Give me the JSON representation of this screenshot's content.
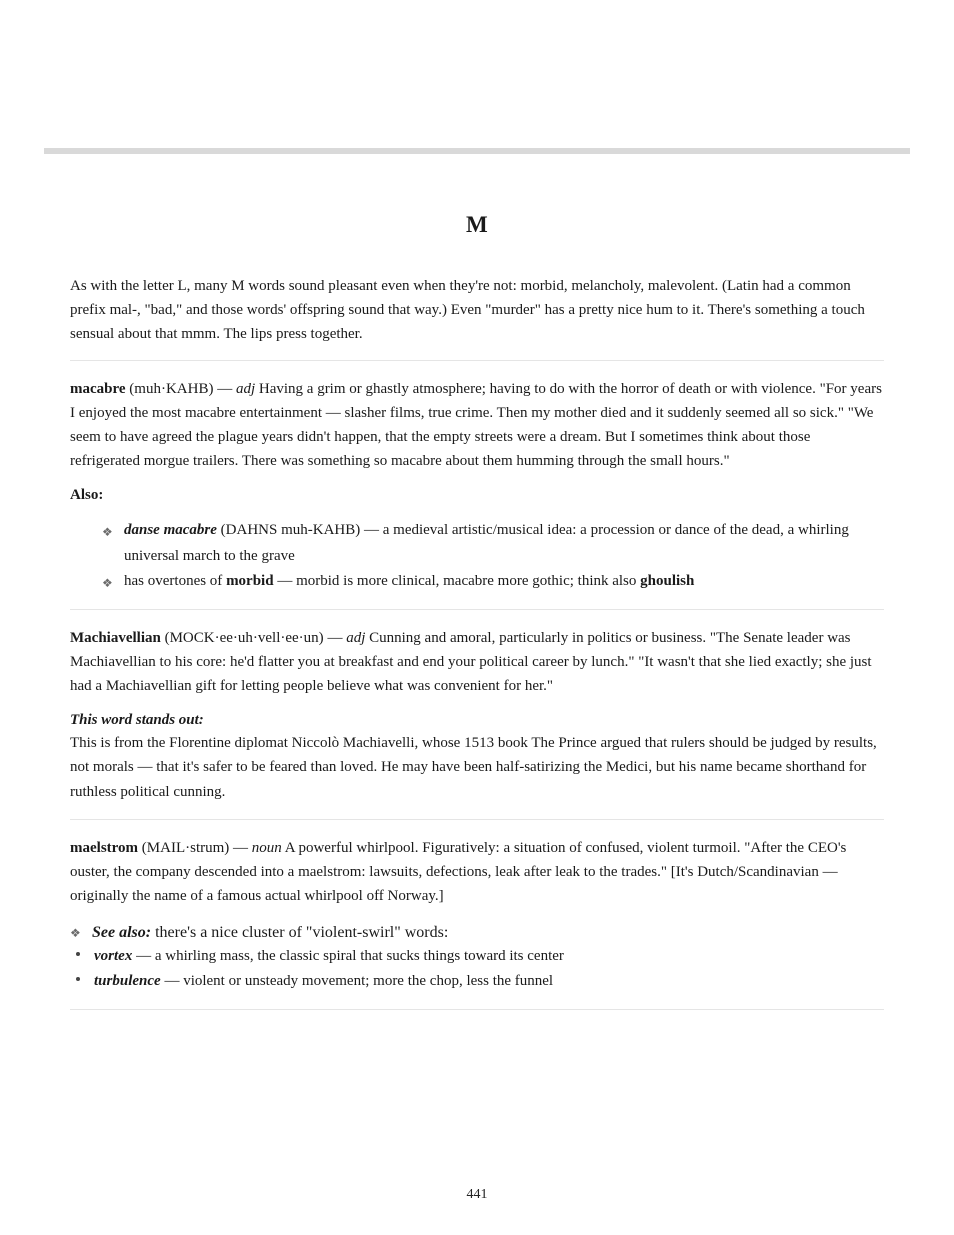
{
  "chapter_title": "M",
  "intro": "As with the letter L, many M words sound pleasant even when they're not: morbid, melancholy, malevolent. (Latin had a common prefix mal-, \"bad,\" and those words' offspring sound that way.) Even \"murder\" has a pretty nice hum to it. There's something a touch sensual about that mmm. The lips press together.",
  "entries": [
    {
      "headword": "macabre",
      "romanization": "(muh·KAHB)",
      "pos": "adj",
      "sense": "Having a grim or ghastly atmosphere; having to do with the horror of death or with violence. \"For years I enjoyed the most macabre entertainment — slasher films, true crime. Then my mother died and it suddenly seemed all so sick.\" \"We seem to have agreed the plague years didn't happen, that the empty streets were a dream. But I sometimes think about those refrigerated morgue trailers. There was something so macabre about them humming through the small hours.\"",
      "also": {
        "head": "Also:",
        "items": [
          {
            "type": "idiom",
            "text": "danse macabre",
            "rest": " (DAHNS muh-KAHB) — a medieval artistic/musical idea: a procession or dance of the dead, a whirling universal march to the grave"
          },
          {
            "type": "synline",
            "prefix": "has overtones of ",
            "syn1": "morbid",
            "mid": " — morbid is more clinical, macabre more gothic; think also ",
            "syn2": "ghoulish"
          }
        ]
      }
    },
    {
      "headword": "Machiavellian",
      "romanization": "(MOCK·ee·uh·vell·ee·un)",
      "pos": "adj",
      "sense": "Cunning and amoral, particularly in politics or business. \"The Senate leader was Machiavellian to his core: he'd flatter you at breakfast and end your political career by lunch.\" \"It wasn't that she lied exactly; she just had a Machiavellian gift for letting people believe what was convenient for her.\"",
      "standouts": {
        "head": "This word stands out:",
        "body": "This is from the Florentine diplomat Niccolò Machiavelli, whose 1513 book The Prince argued that rulers should be judged by results, not morals — that it's safer to be feared than loved. He may have been half-satirizing the Medici, but his name became shorthand for ruthless political cunning."
      }
    },
    {
      "headword": "maelstrom",
      "romanization": "(MAIL·strum)",
      "pos": "noun",
      "sense": "A powerful whirlpool. Figuratively: a situation of confused, violent turmoil. \"After the CEO's ouster, the company descended into a maelstrom: lawsuits, defections, leak after leak to the trades.\" [It's Dutch/Scandinavian — originally the name of a famous actual whirlpool off Norway.]",
      "see": {
        "head_lead": "See also: ",
        "head_rest": "there's a nice cluster of \"violent-swirl\" words:",
        "items": [
          {
            "word": "vortex",
            "rest": " — a whirling mass, the classic spiral that sucks things toward its center"
          },
          {
            "word": "turbulence",
            "rest": " — violent or unsteady movement; more the chop, less the funnel"
          }
        ]
      }
    }
  ],
  "page_number": "441"
}
